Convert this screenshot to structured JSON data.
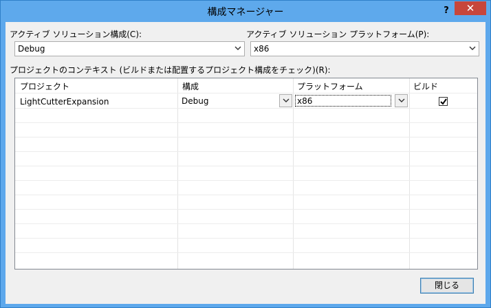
{
  "window": {
    "title": "構成マネージャー",
    "help_label": "?",
    "close_label": "✕"
  },
  "active_solution_config": {
    "label": "アクティブ ソリューション構成(C):",
    "value": "Debug"
  },
  "active_solution_platform": {
    "label": "アクティブ ソリューション プラットフォーム(P):",
    "value": "x86"
  },
  "project_contexts": {
    "label": "プロジェクトのコンテキスト (ビルドまたは配置するプロジェクト構成をチェック)(R):",
    "columns": [
      "プロジェクト",
      "構成",
      "プラットフォーム",
      "ビルド"
    ],
    "rows": [
      {
        "project": "LightCutterExpansion",
        "configuration": "Debug",
        "platform": "x86",
        "build": true
      }
    ]
  },
  "buttons": {
    "close": "閉じる"
  }
}
